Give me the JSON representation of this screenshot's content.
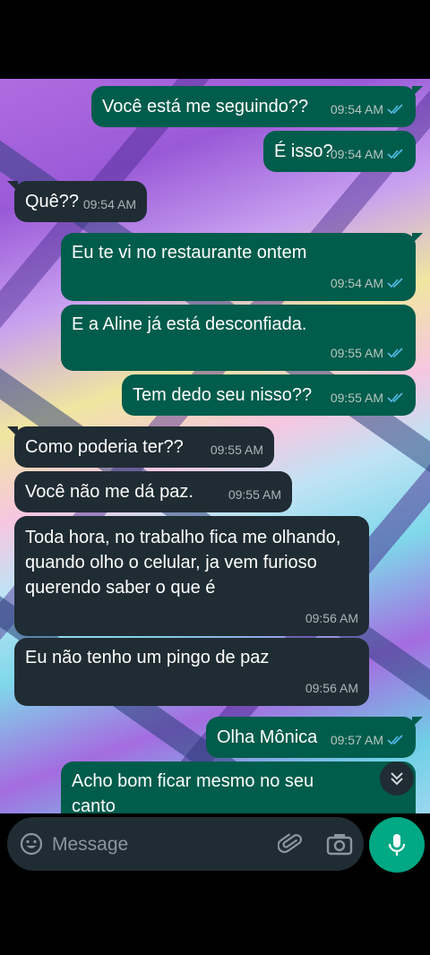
{
  "messages": [
    {
      "text": "Você está me seguindo??",
      "time": "09:54 AM",
      "dir": "out"
    },
    {
      "text": "É isso?",
      "time": "09:54 AM",
      "dir": "out"
    },
    {
      "text": "Quê??",
      "time": "09:54 AM",
      "dir": "in"
    },
    {
      "text": "Eu te vi no restaurante ontem",
      "time": "09:54 AM",
      "dir": "out"
    },
    {
      "text": "E a Aline já está desconfiada.",
      "time": "09:55 AM",
      "dir": "out"
    },
    {
      "text": "Tem dedo seu nisso??",
      "time": "09:55 AM",
      "dir": "out"
    },
    {
      "text": "Como poderia ter??",
      "time": "09:55 AM",
      "dir": "in"
    },
    {
      "text": "Você não me dá paz.",
      "time": "09:55 AM",
      "dir": "in"
    },
    {
      "text": "Toda hora, no trabalho fica me olhando, quando olho o celular, ja vem furioso querendo saber o que é",
      "time": "09:56 AM",
      "dir": "in"
    },
    {
      "text": "Eu não tenho um pingo de paz",
      "time": "09:56 AM",
      "dir": "in"
    },
    {
      "text": "Olha Mônica",
      "time": "09:57 AM",
      "dir": "out"
    },
    {
      "text": "Acho bom ficar mesmo no seu canto",
      "time": "",
      "dir": "out"
    }
  ],
  "composer": {
    "placeholder": "Message"
  },
  "icons": {
    "emoji": "emoji-icon",
    "attach": "paperclip-icon",
    "camera": "camera-icon",
    "mic": "microphone-icon",
    "scroll": "chevrons-down-icon",
    "read": "double-check-icon"
  },
  "colors": {
    "outgoing_bubble": "#005c4b",
    "incoming_bubble": "#202c33",
    "read_tick": "#53bdeb",
    "accent": "#00a884"
  }
}
